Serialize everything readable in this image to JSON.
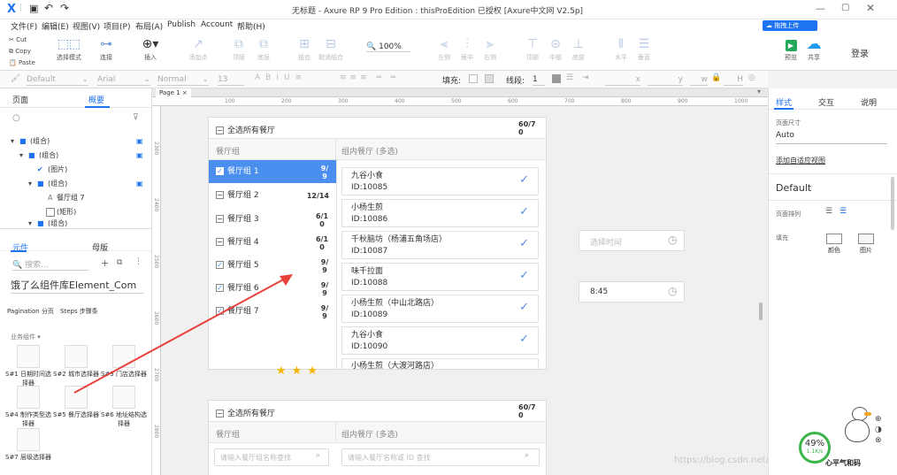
{
  "titlebar": {
    "title": "无标题 - Axure RP 9 Pro Edition : thisProEdition 已授权    [Axure中文网 V2.5p]"
  },
  "menu": [
    "文件(F)",
    "编辑(E)",
    "视图(V)",
    "项目(P)",
    "布局(A)",
    "Publish",
    "Account",
    "帮助(H)"
  ],
  "upload_label": "拖拽上传",
  "clipboard": {
    "cut": "Cut",
    "copy": "Copy",
    "paste": "Paste"
  },
  "toolbar": {
    "select_mode": "选择模式",
    "connect": "连接",
    "insert": "插入",
    "point": "添加点",
    "top": "顶层",
    "bottom": "底层",
    "group": "组合",
    "ungroup": "取消组合",
    "zoom": "100%",
    "left": "左侧",
    "center": "居中",
    "right": "右侧",
    "top_align": "顶部",
    "middle": "中部",
    "bottom_align": "底部",
    "horizontal": "水平",
    "vertical": "垂直",
    "preview": "预览",
    "share": "共享",
    "login": "登录"
  },
  "stylebar": {
    "style": "Default",
    "font": "Arial",
    "weight": "Normal",
    "size": "13",
    "fill_label": "填充:",
    "stroke_label": "线段:",
    "stroke_val": "1",
    "x": "x",
    "y": "y",
    "w": "w",
    "h": "H"
  },
  "left": {
    "tabs": [
      "页面",
      "概要"
    ],
    "tree": [
      {
        "label": "(组合)",
        "indent": 0
      },
      {
        "label": "(组合)",
        "indent": 1
      },
      {
        "label": "(图片)",
        "indent": 2
      },
      {
        "label": "(组合)",
        "indent": 2
      },
      {
        "label": "餐厅组 7",
        "indent": 3
      },
      {
        "label": "(矩形)",
        "indent": 3
      },
      {
        "label": "(组合)",
        "indent": 2
      }
    ],
    "lib_tabs": [
      "元件",
      "母版"
    ],
    "search_placeholder": "搜索...",
    "lib_name": "饿了么组件库Element_Com",
    "sub_tabs": [
      "Pagination 分页",
      "Steps 步骤条"
    ],
    "section": "业务组件",
    "items": [
      "S#1 日期时间选择器",
      "S#2 城市选择器",
      "S#3 门店选择器",
      "S#4 制作类型选择器",
      "S#5 餐厅选择器",
      "S#6 地址结构选择器",
      "S#7 层级选择器"
    ]
  },
  "canvas": {
    "page_tab": "Page 1",
    "ruler_h": [
      "100",
      "200",
      "300",
      "400",
      "500",
      "600",
      "700",
      "800",
      "900",
      "1000"
    ],
    "ruler_v": [
      "2300",
      "2400",
      "2500",
      "2600",
      "2700",
      "2800"
    ],
    "comp1": {
      "select_all": "全选所有餐厅",
      "count": "60/70",
      "col_group": "餐厅组",
      "col_rest": "组内餐厅 (多选)",
      "groups": [
        {
          "name": "餐厅组 1",
          "count": "9/9",
          "state": "checked",
          "active": true
        },
        {
          "name": "餐厅组 2",
          "count": "12/14",
          "state": "partial",
          "active": false
        },
        {
          "name": "餐厅组 3",
          "count": "6/10",
          "state": "partial",
          "active": false
        },
        {
          "name": "餐厅组 4",
          "count": "6/10",
          "state": "partial",
          "active": false
        },
        {
          "name": "餐厅组 5",
          "count": "9/9",
          "state": "checked",
          "active": false
        },
        {
          "name": "餐厅组 6",
          "count": "9/9",
          "state": "checked",
          "active": false
        },
        {
          "name": "餐厅组 7",
          "count": "9/9",
          "state": "checked",
          "active": false
        }
      ],
      "restaurants": [
        {
          "name": "九谷小食",
          "id": "ID:10085"
        },
        {
          "name": "小杨生煎",
          "id": "ID:10086"
        },
        {
          "name": "千秋脑坊（杨浦五角场店）",
          "id": "ID:10087"
        },
        {
          "name": "味千拉面",
          "id": "ID:10088"
        },
        {
          "name": "小杨生煎（中山北路店）",
          "id": "ID:10089"
        },
        {
          "name": "九谷小食",
          "id": "ID:10090"
        },
        {
          "name": "小杨生煎（大渡河路店）",
          "id": ""
        }
      ]
    },
    "time1_placeholder": "选择时间",
    "time2_value": "8:45",
    "comp2": {
      "select_all": "全选所有餐厅",
      "count": "60/70",
      "col_group": "餐厅组",
      "col_rest": "组内餐厅 (多选)",
      "group_search": "请输入餐厅组名称查找",
      "rest_search": "请输入餐厅名称或 ID 查找"
    },
    "watermark": "https://blog.csdn.net/...",
    "stamp": "心平气和码",
    "progress": "49%",
    "speed": "1.1K/s"
  },
  "right": {
    "tabs": [
      "样式",
      "交互",
      "说明"
    ],
    "page_size_label": "页面尺寸",
    "page_size": "Auto",
    "adaptive": "添加自适应视图",
    "style": "Default",
    "align_label": "页面排列",
    "fill_label": "填充",
    "color_label": "颜色",
    "image_label": "图片"
  },
  "colors": {
    "accent": "#1e73f0",
    "active_row": "#4a8ff0",
    "arrow": "#e8413c",
    "star": "#f5b400"
  }
}
